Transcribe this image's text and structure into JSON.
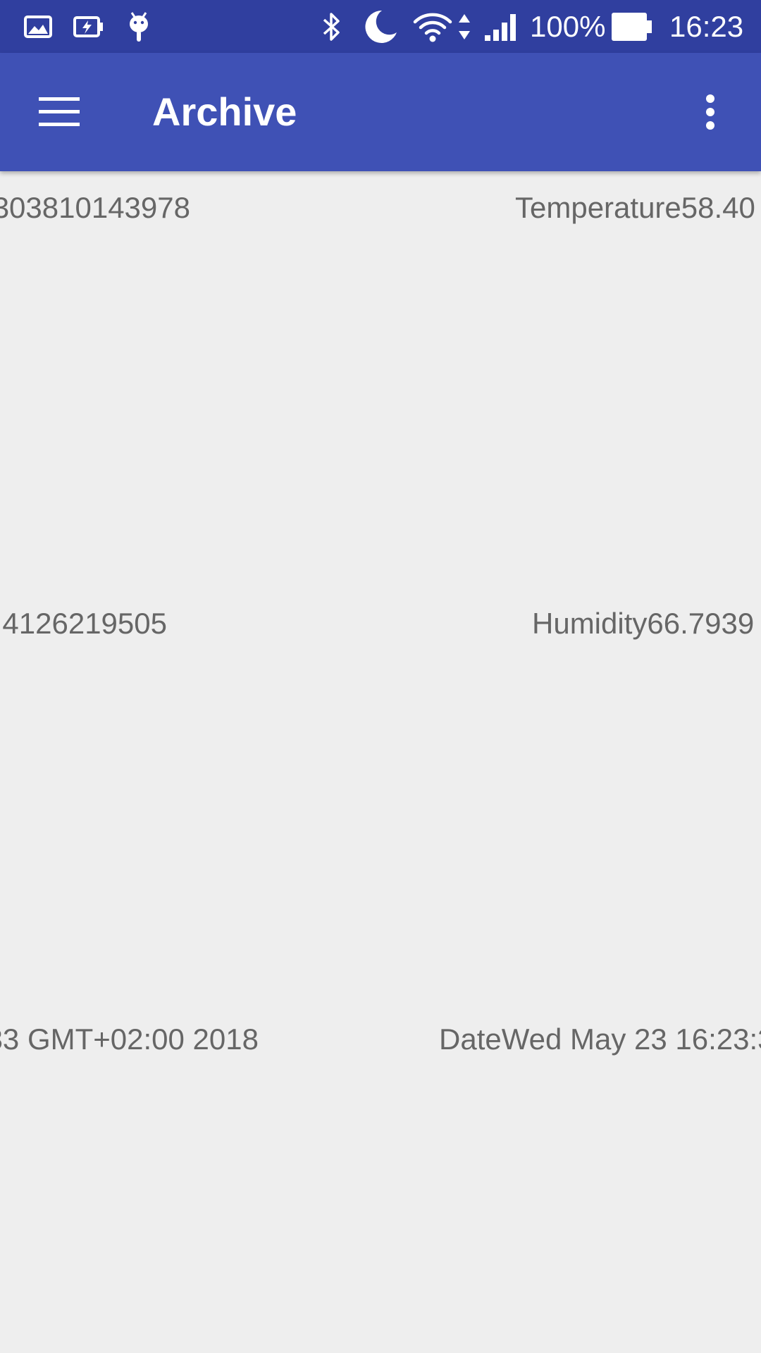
{
  "status_bar": {
    "icons": [
      "gallery-icon",
      "battery-saver-icon",
      "android-debug-icon",
      "bluetooth-icon",
      "do-not-disturb-moon-icon",
      "wifi-icon",
      "data-arrows-icon",
      "cell-signal-icon",
      "battery-icon"
    ],
    "battery_percent": "100%",
    "time": "16:23"
  },
  "app_bar": {
    "title": "Archive",
    "color": "#3f51b5",
    "status_color": "#303f9f",
    "menu_icon": "hamburger-menu-icon",
    "overflow_icon": "more-vert-icon"
  },
  "rows": [
    {
      "left": "303810143978",
      "right": "Temperature58.40"
    },
    {
      "left": "4126219505",
      "right": "Humidity66.7939"
    },
    {
      "left": "33 GMT+02:00 2018",
      "right": "DateWed May 23 16:23:3"
    }
  ]
}
